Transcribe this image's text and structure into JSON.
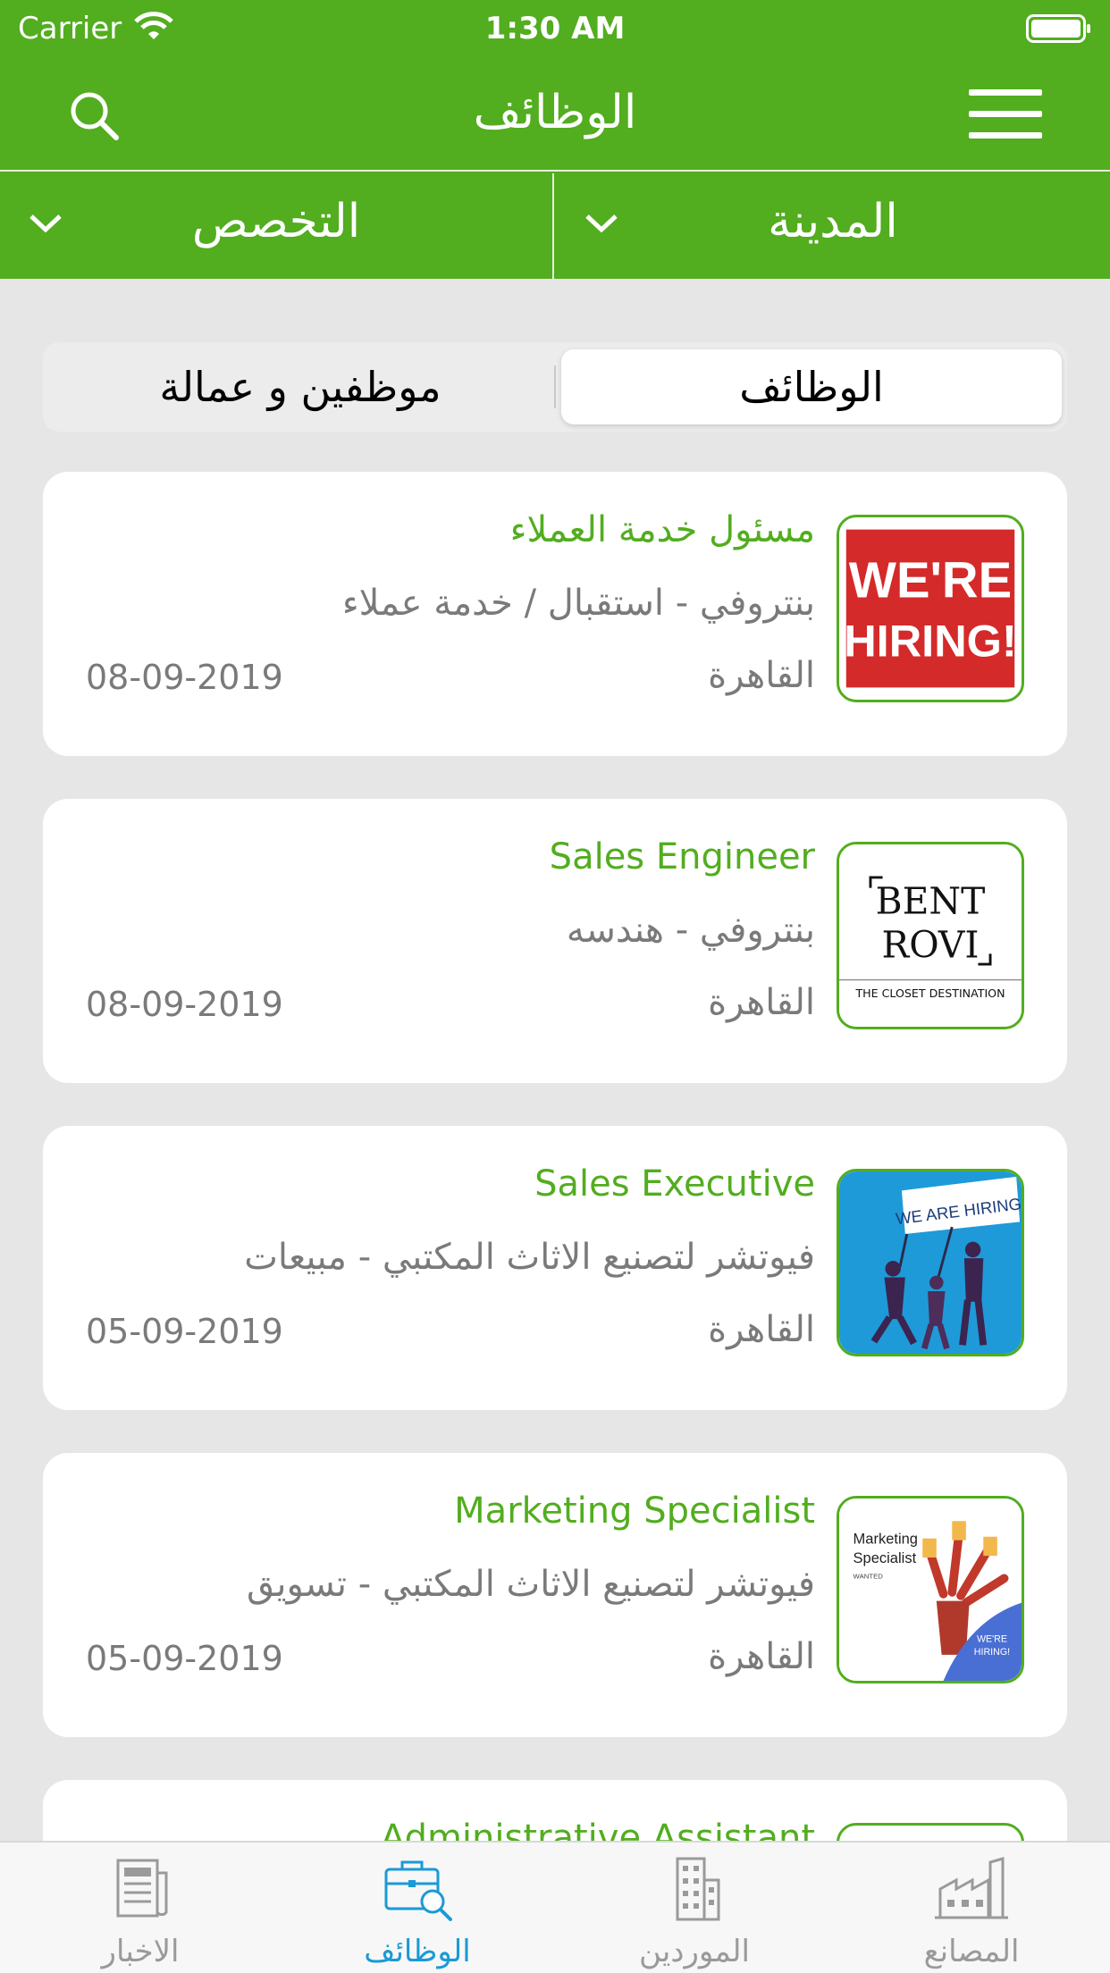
{
  "status_bar": {
    "carrier": "Carrier",
    "time": "1:30 AM"
  },
  "header": {
    "title": "الوظائف"
  },
  "filters": {
    "city": "المدينة",
    "specialty": "التخصص"
  },
  "segment": {
    "jobs": "الوظائف",
    "employees": "موظفين و عمالة"
  },
  "jobs": [
    {
      "title": "مسئول خدمة العملاء",
      "company_field": "بنتروفي - استقبال / خدمة عملاء",
      "city": "القاهرة",
      "date": "08-09-2019",
      "thumb": {
        "line1": "WE'RE",
        "line2": "HIRING!"
      }
    },
    {
      "title": "Sales Engineer",
      "company_field": "بنتروفي - هندسه",
      "city": "القاهرة",
      "date": "08-09-2019",
      "thumb": {
        "line1": "BENT",
        "line2": "ROVI",
        "tagline": "THE CLOSET DESTINATION"
      }
    },
    {
      "title": "Sales Executive",
      "company_field": "فيوتشر لتصنيع الاثاث المكتبي - مبيعات",
      "city": "القاهرة",
      "date": "05-09-2019",
      "thumb": {
        "sign": "WE ARE HIRING!"
      }
    },
    {
      "title": "Marketing Specialist",
      "company_field": "فيوتشر لتصنيع الاثاث المكتبي - تسويق",
      "city": "القاهرة",
      "date": "05-09-2019",
      "thumb": {
        "line1": "Marketing",
        "line2": "Specialist",
        "small": "WANTED",
        "corner1": "WE'RE",
        "corner2": "HIRING!"
      }
    },
    {
      "title": "Administrative Assistant",
      "company_field": "",
      "city": "",
      "date": ""
    }
  ],
  "tabbar": [
    {
      "label": "المصانع",
      "icon": "factory-icon",
      "active": false
    },
    {
      "label": "الموردين",
      "icon": "building-icon",
      "active": false
    },
    {
      "label": "الوظائف",
      "icon": "briefcase-search-icon",
      "active": true
    },
    {
      "label": "الاخبار",
      "icon": "newspaper-icon",
      "active": false
    }
  ],
  "colors": {
    "primary": "#52ad1f",
    "tab_active": "#1a9ad6",
    "text_muted": "#7a7a7a",
    "background": "#e6e6e6"
  }
}
